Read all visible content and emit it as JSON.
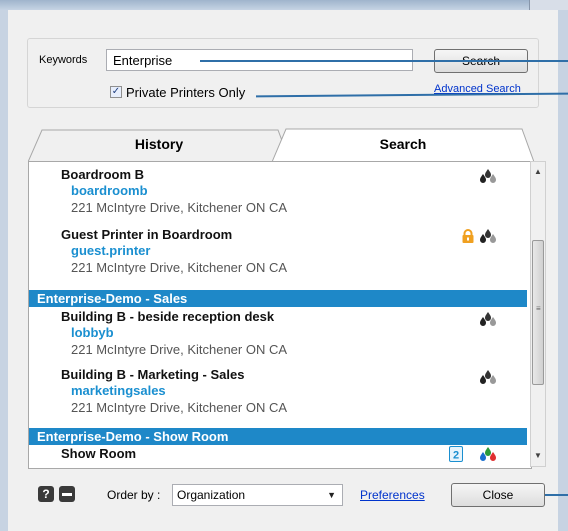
{
  "search": {
    "keywords_label": "Keywords",
    "keywords_value": "Enterprise",
    "search_button": "Search",
    "private_only_label": "Private Printers Only",
    "private_only_checked": true,
    "advanced_link": "Advanced Search"
  },
  "tabs": [
    {
      "label": "History",
      "active": false
    },
    {
      "label": "Search",
      "active": true
    }
  ],
  "list": {
    "items": [
      {
        "name": "Boardroom B",
        "id": "boardroomb",
        "address": "221 McIntyre Drive, Kitchener ON CA",
        "icons": [
          "drops-mono"
        ]
      },
      {
        "name": "Guest Printer in Boardroom",
        "id": "guest.printer",
        "address": "221 McIntyre Drive, Kitchener ON CA",
        "icons": [
          "lock",
          "drops-mono"
        ]
      }
    ],
    "groups": [
      {
        "title": "Enterprise-Demo - Sales",
        "items": [
          {
            "name": "Building B - beside reception desk",
            "id": "lobbyb",
            "address": "221 McIntyre Drive, Kitchener ON CA",
            "icons": [
              "drops-mono"
            ]
          },
          {
            "name": "Building B - Marketing - Sales",
            "id": "marketingsales",
            "address": "221 McIntyre Drive, Kitchener ON CA",
            "icons": [
              "drops-mono"
            ]
          }
        ]
      },
      {
        "title": "Enterprise-Demo - Show Room",
        "items": [
          {
            "name": "Show Room",
            "icons": [
              "duplex-2",
              "drops-color"
            ]
          }
        ]
      }
    ]
  },
  "footer": {
    "help_icon": "?",
    "order_label": "Order by :",
    "order_value": "Organization",
    "preferences_link": "Preferences",
    "close_button": "Close"
  },
  "colors": {
    "group_header": "#1e88c8",
    "printer_id": "#1a8fd0",
    "callout": "#2f6fa8",
    "lock": "#f0a020"
  }
}
